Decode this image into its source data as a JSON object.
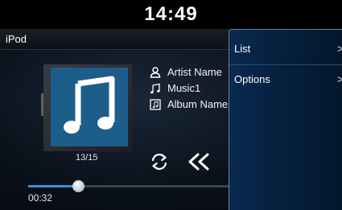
{
  "status_bar": {
    "time": "14:49"
  },
  "header": {
    "source": "iPod"
  },
  "now_playing": {
    "artist": "Artist Name",
    "song": "Music1",
    "album": "Album Name",
    "track_index": "13/15",
    "elapsed": "00:32",
    "progress_fraction": 0.24
  },
  "popup_menu": {
    "items": [
      {
        "label": "List",
        "chevron": ">"
      },
      {
        "label": "Options",
        "chevron": ">"
      }
    ]
  },
  "colors": {
    "album_art": "#1c5d8a",
    "progress_fill": "#3d8fd6",
    "popup_background": "#0a2a52"
  },
  "icons": {
    "artist": "person-icon",
    "song": "music-note-icon",
    "album": "album-icon",
    "repeat": "repeat-icon",
    "previous": "previous-track-icon"
  }
}
